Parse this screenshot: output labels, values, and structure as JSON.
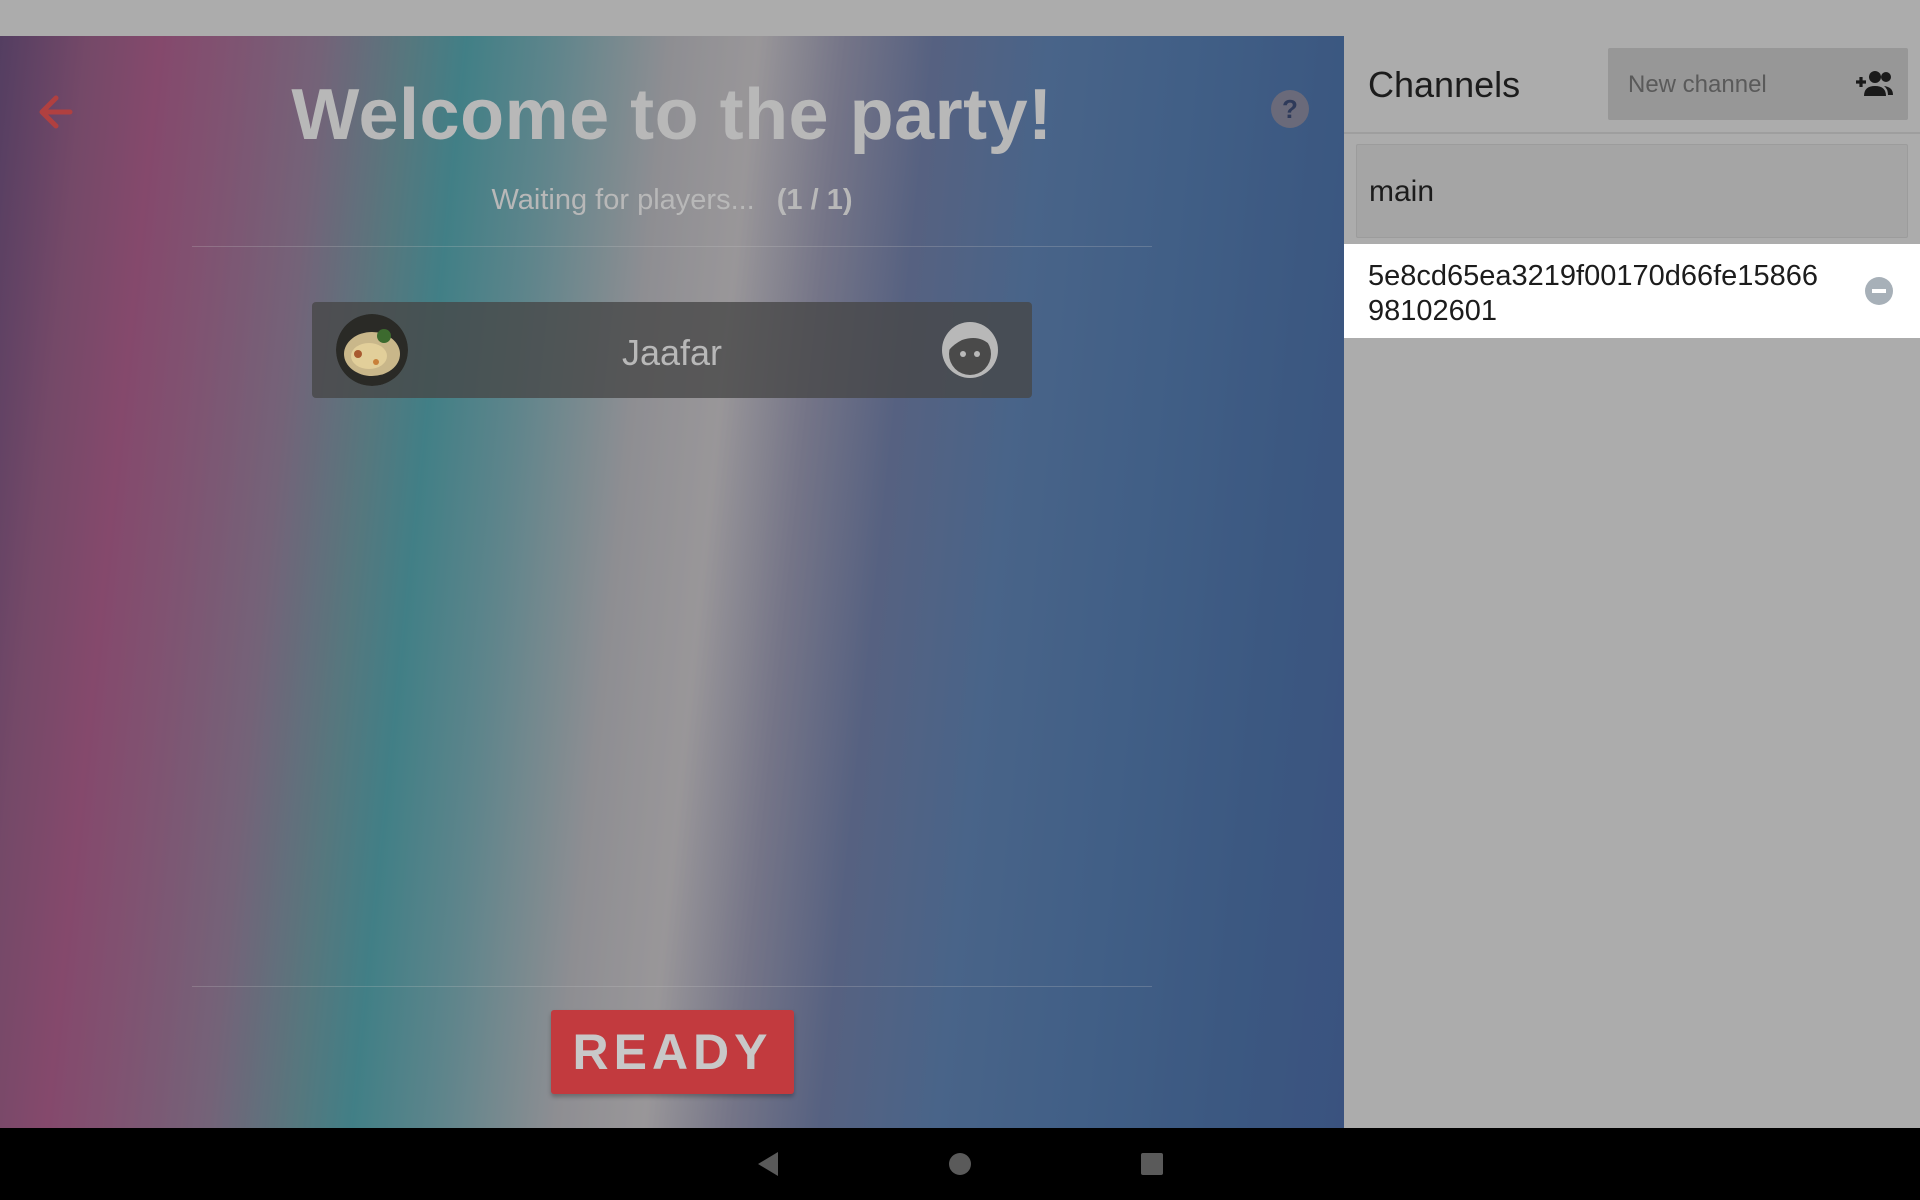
{
  "lobby": {
    "title": "Welcome to the party!",
    "waiting_text": "Waiting for players...",
    "player_count": "(1 / 1)",
    "players": [
      {
        "name": "Jaafar",
        "avatar": "food-photo-avatar",
        "status_icon": "face-icon"
      }
    ],
    "ready_label": "READY",
    "back_icon": "arrow-left-icon",
    "help_icon": "question-mark-icon"
  },
  "channels": {
    "title": "Channels",
    "new_channel_placeholder": "New channel",
    "add_icon": "add-user-icon",
    "items": [
      {
        "label": "main",
        "selected": false
      },
      {
        "label": "5e8cd65ea3219f00170d66fe1586698102601",
        "selected": true,
        "remove_icon": "minus-circle-icon"
      }
    ]
  },
  "colors": {
    "ready_button": "#c23a3e",
    "back_arrow": "#b04040",
    "panel_bg": "#acacac",
    "selected_channel_bg": "#ffffff"
  },
  "system_nav": [
    "back-triangle-icon",
    "home-circle-icon",
    "recents-square-icon"
  ]
}
